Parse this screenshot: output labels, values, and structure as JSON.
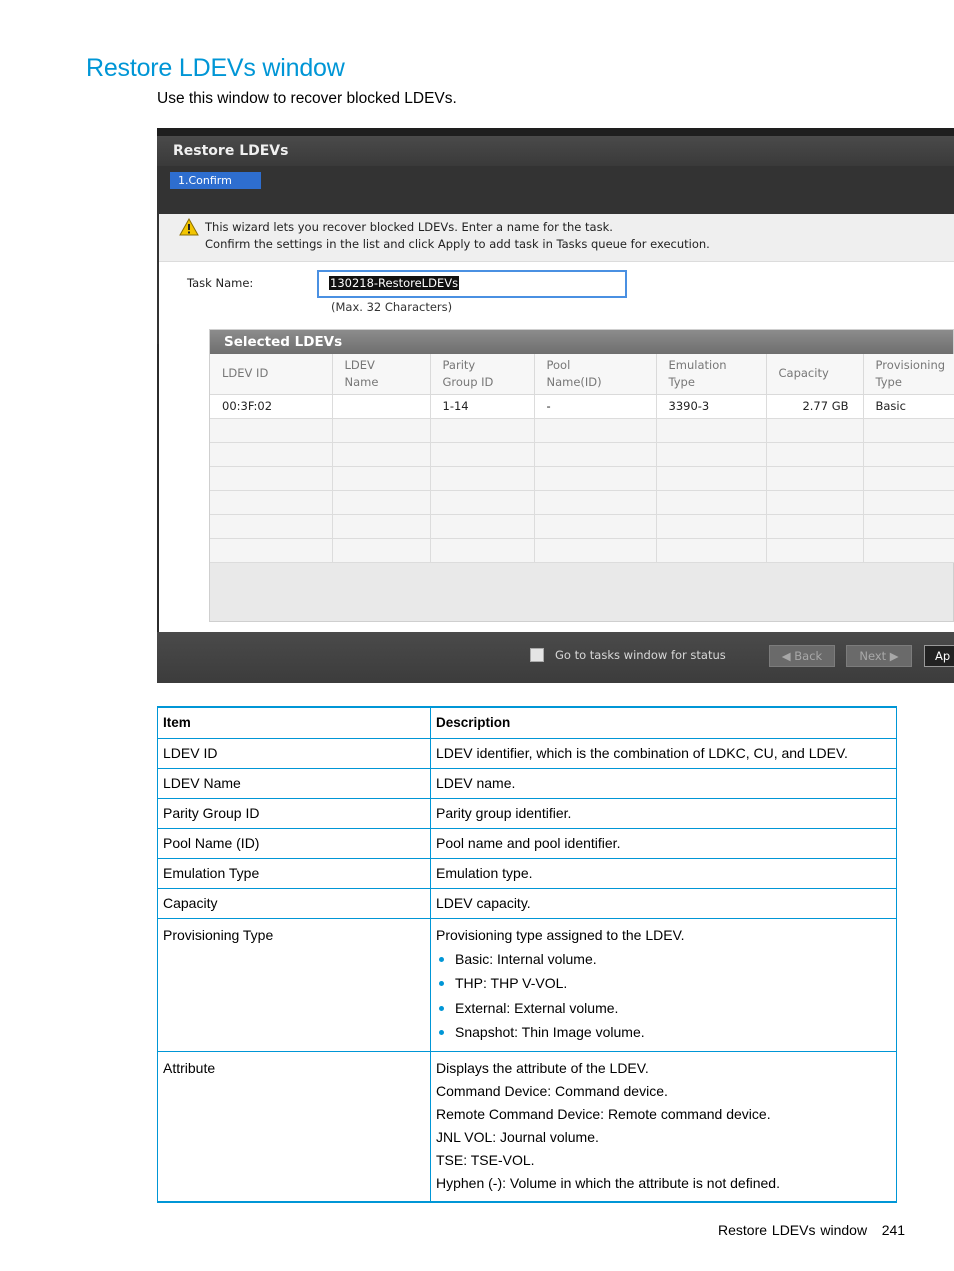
{
  "page": {
    "title": "Restore LDEVs window",
    "intro": "Use this window to recover blocked LDEVs.",
    "footer_text": "Restore LDEVs window",
    "page_number": "241"
  },
  "dialog": {
    "title": "Restore LDEVs",
    "step": "1.Confirm",
    "notice_line1": "This wizard lets you recover blocked LDEVs. Enter a name for the task.",
    "notice_line2": "Confirm the settings in the list and click Apply to add task in Tasks queue for execution.",
    "task_label": "Task Name:",
    "task_value": "130218-RestoreLDEVs",
    "task_hint": "(Max. 32 Characters)",
    "grid_title": "Selected LDEVs",
    "columns": [
      [
        "LDEV ID",
        ""
      ],
      [
        "LDEV",
        "Name"
      ],
      [
        "Parity",
        "Group ID"
      ],
      [
        "Pool",
        "Name(ID)"
      ],
      [
        "Emulation",
        "Type"
      ],
      [
        "Capacity",
        ""
      ],
      [
        "Provisioning",
        "Type"
      ]
    ],
    "row": {
      "ldev_id": "00:3F:02",
      "ldev_name": "",
      "parity_group": "1-14",
      "pool": "-",
      "emulation": "3390-3",
      "capacity": "2.77 GB",
      "provisioning": "Basic"
    },
    "go_to_tasks_label": "Go to tasks window for status",
    "back_label": "◀ Back",
    "next_label": "Next ▶",
    "apply_label": "Ap"
  },
  "table": {
    "headers": {
      "item": "Item",
      "description": "Description"
    },
    "rows": [
      {
        "item": "LDEV ID",
        "description": "LDEV identifier, which is the combination of LDKC, CU, and LDEV."
      },
      {
        "item": "LDEV Name",
        "description": "LDEV name."
      },
      {
        "item": "Parity Group ID",
        "description": "Parity group identifier."
      },
      {
        "item": "Pool Name (ID)",
        "description": "Pool name and pool identifier."
      },
      {
        "item": "Emulation Type",
        "description": "Emulation type."
      },
      {
        "item": "Capacity",
        "description": "LDEV capacity."
      }
    ],
    "provisioning": {
      "item": "Provisioning Type",
      "intro": "Provisioning type assigned to the LDEV.",
      "bullets": [
        "Basic: Internal volume.",
        "THP: THP V-VOL.",
        "External: External volume.",
        "Snapshot: Thin Image volume."
      ]
    },
    "attribute": {
      "item": "Attribute",
      "lines": [
        "Displays the attribute of the LDEV.",
        "Command Device: Command device.",
        "Remote Command Device: Remote command device.",
        "JNL VOL: Journal volume.",
        "TSE: TSE-VOL.",
        "Hyphen (-): Volume in which the attribute is not defined."
      ]
    }
  },
  "colors": {
    "accent": "#0096d6"
  }
}
